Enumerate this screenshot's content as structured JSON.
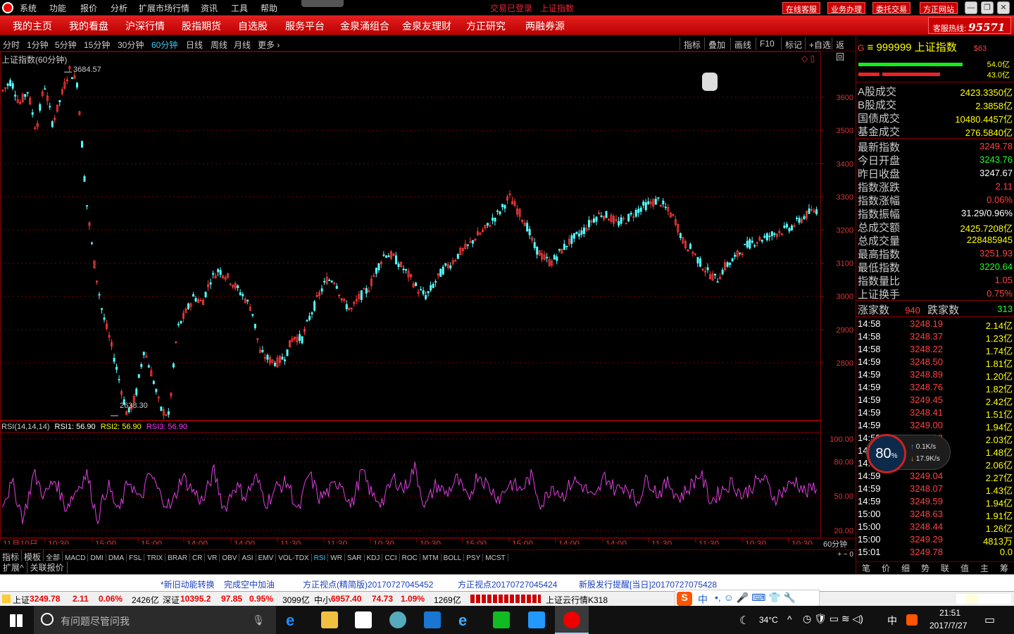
{
  "titlebar": {
    "menus": [
      "系统",
      "功能",
      "报价",
      "分析",
      "扩展市场行情",
      "资讯",
      "工具",
      "帮助"
    ],
    "status_login": "交易已登录",
    "status_index": "上证指数",
    "buttons": [
      "在线客服",
      "业务办理",
      "委托交易",
      "方正网站"
    ]
  },
  "nav": {
    "items": [
      "我的主页",
      "我的看盘",
      "沪深行情",
      "股指期货",
      "自选股",
      "服务平台",
      "金泉涌组合",
      "金泉友理财",
      "方正研究",
      "两融券源"
    ],
    "hotline_label": "客服热线:",
    "hotline_number": "95571"
  },
  "toolbar": {
    "periods": [
      "分时",
      "1分钟",
      "5分钟",
      "15分钟",
      "30分钟",
      "60分钟",
      "日线",
      "周线",
      "月线",
      "更多 ›"
    ],
    "selected_period": "60分钟",
    "right_buttons": [
      "指标",
      "叠加",
      "画线",
      "F10",
      "标记",
      "+自选",
      "返回"
    ]
  },
  "chart": {
    "title": "上证指数(60分钟)",
    "rsi_title": "RSI(14,14,14)",
    "rsi1": "RSI1: 56.90",
    "rsi2": "RSI2: 56.90",
    "rsi3": "RSI3: 56.90",
    "high_label": "3684.57",
    "low_label": "2638.30",
    "period_label": "60分钟",
    "x_labels": [
      "11月10日",
      "10:30",
      "15:00",
      "15:00",
      "14:00",
      "14:00",
      "11:30",
      "11:30",
      "10:30",
      "10:30",
      "15:00",
      "15:00",
      "14:00",
      "14:00",
      "11:30",
      "11:30",
      "10:30",
      "10:30"
    ]
  },
  "chart_data": {
    "type": "candlestick",
    "title": "上证指数(60分钟)",
    "price_axis": {
      "ticks": [
        2800,
        2900,
        3000,
        3100,
        3200,
        3300,
        3400,
        3500,
        3600
      ],
      "range": [
        2630,
        3700
      ]
    },
    "rsi_axis": {
      "ticks": [
        20.0,
        50.0,
        80.0,
        100.0
      ],
      "range": [
        15,
        105
      ]
    },
    "high": 3684.57,
    "low": 2638.3,
    "price_path": [
      3620,
      3650,
      3580,
      3620,
      3500,
      3640,
      3520,
      3600,
      3684,
      3640,
      3300,
      3100,
      2950,
      2860,
      2750,
      2640,
      2700,
      2840,
      2760,
      2660,
      2640,
      2900,
      2950,
      3000,
      2980,
      3050,
      3080,
      3060,
      3030,
      3000,
      2960,
      2830,
      2810,
      2800,
      2820,
      2880,
      2870,
      2940,
      3000,
      3050,
      3050,
      2980,
      2960,
      3000,
      3020,
      3080,
      3130,
      3120,
      3090,
      3060,
      3020,
      3000,
      3040,
      3080,
      3100,
      3130,
      3150,
      3180,
      3200,
      3230,
      3260,
      3300,
      3260,
      3220,
      3150,
      3120,
      3100,
      3130,
      3160,
      3180,
      3200,
      3230,
      3250,
      3240,
      3220,
      3230,
      3250,
      3270,
      3280,
      3290,
      3260,
      3230,
      3160,
      3140,
      3100,
      3070,
      3050,
      3090,
      3110,
      3140,
      3160,
      3170,
      3180,
      3190,
      3200,
      3210,
      3230,
      3250,
      3260
    ],
    "rsi_path": [
      45,
      60,
      30,
      70,
      50,
      65,
      40,
      55,
      70,
      30,
      60,
      35,
      65,
      45,
      70,
      50,
      40,
      68,
      55,
      45,
      72,
      38,
      60,
      50,
      66,
      44,
      58,
      62,
      35,
      70,
      48,
      55,
      64,
      40,
      72,
      50,
      45,
      66,
      56,
      75,
      40,
      60,
      52,
      65,
      46,
      70,
      58,
      48,
      62,
      55,
      67,
      42,
      60,
      50,
      64,
      58,
      46,
      68,
      55,
      60,
      44,
      66,
      52,
      62,
      48,
      58,
      70,
      45,
      55,
      62,
      50,
      60,
      66,
      48,
      56,
      64,
      52,
      60
    ]
  },
  "panel": {
    "code_prefix": "G",
    "code": "999999",
    "name": "上证指数",
    "badge": "$63",
    "bar1_value": "54.0亿",
    "bar2_value": "43.0亿",
    "stats1": [
      {
        "k": "A股成交",
        "v": "2423.3350亿",
        "c": "yel"
      },
      {
        "k": "B股成交",
        "v": "2.3858亿",
        "c": "yel"
      },
      {
        "k": "国债成交",
        "v": "10480.4457亿",
        "c": "yel"
      },
      {
        "k": "基金成交",
        "v": "276.5840亿",
        "c": "yel"
      }
    ],
    "stats2": [
      {
        "k": "最新指数",
        "v": "3249.78",
        "c": "red"
      },
      {
        "k": "今日开盘",
        "v": "3243.76",
        "c": "grn"
      },
      {
        "k": "昨日收盘",
        "v": "3247.67",
        "c": "wht"
      },
      {
        "k": "指数涨跌",
        "v": "2.11",
        "c": "red"
      },
      {
        "k": "指数涨幅",
        "v": "0.06%",
        "c": "red"
      },
      {
        "k": "指数振幅",
        "v": "31.29/0.96%",
        "c": "wht"
      },
      {
        "k": "总成交额",
        "v": "2425.7208亿",
        "c": "yel"
      },
      {
        "k": "总成交量",
        "v": "228485945",
        "c": "yel"
      },
      {
        "k": "最高指数",
        "v": "3251.93",
        "c": "red"
      },
      {
        "k": "最低指数",
        "v": "3220.64",
        "c": "grn"
      },
      {
        "k": "指数量比",
        "v": "1.05",
        "c": "red"
      },
      {
        "k": "上证换手",
        "v": "0.75%",
        "c": "red"
      }
    ],
    "rise_label": "涨家数",
    "rise": "940",
    "fall_label": "跌家数",
    "fall": "313",
    "ticks": [
      {
        "t": "14:58",
        "p": "3248.19",
        "v": "2.14亿"
      },
      {
        "t": "14:58",
        "p": "3248.37",
        "v": "1.23亿"
      },
      {
        "t": "14:58",
        "p": "3248.22",
        "v": "1.74亿"
      },
      {
        "t": "14:59",
        "p": "3248.50",
        "v": "1.81亿"
      },
      {
        "t": "14:59",
        "p": "3248.89",
        "v": "1.20亿"
      },
      {
        "t": "14:59",
        "p": "3248.76",
        "v": "1.82亿"
      },
      {
        "t": "14:59",
        "p": "3249.45",
        "v": "2.42亿"
      },
      {
        "t": "14:59",
        "p": "3248.41",
        "v": "1.51亿"
      },
      {
        "t": "14:59",
        "p": "3249.00",
        "v": "1.94亿"
      },
      {
        "t": "14:59",
        "p": "3247.93",
        "v": "2.03亿"
      },
      {
        "t": "14:59",
        "p": "",
        "v": "1.48亿"
      },
      {
        "t": "14:59",
        "p": "",
        "v": "2.06亿"
      },
      {
        "t": "14:59",
        "p": "3249.04",
        "v": "2.27亿"
      },
      {
        "t": "14:59",
        "p": "3248.07",
        "v": "1.43亿"
      },
      {
        "t": "14:59",
        "p": "3249.59",
        "v": "1.94亿"
      },
      {
        "t": "15:00",
        "p": "3248.63",
        "v": "1.91亿"
      },
      {
        "t": "15:00",
        "p": "3248.44",
        "v": "1.26亿"
      },
      {
        "t": "15:00",
        "p": "3249.29",
        "v": "4813万"
      },
      {
        "t": "15:01",
        "p": "3249.78",
        "v": "0.0"
      }
    ],
    "tabs": [
      "笔",
      "价",
      "细",
      "势",
      "联",
      "值",
      "主",
      "筹"
    ]
  },
  "bottom_tabs": {
    "row1": [
      "指标",
      "模板",
      "全部",
      "MACD",
      "DMI",
      "DMA",
      "FSL",
      "TRIX",
      "BRAR",
      "CR",
      "VR",
      "OBV",
      "ASI",
      "EMV",
      "VOL-TDX",
      "RSI",
      "WR",
      "SAR",
      "KDJ",
      "CCI",
      "ROC",
      "MTM",
      "BOLL",
      "PSY",
      "MCST"
    ],
    "row2": [
      "扩展^",
      "关联报价"
    ]
  },
  "news": [
    "*新旧动能转换",
    "完成空中加油",
    "方正视点(精简版)20170727045452",
    "方正视点20170727045424",
    "新股发行提醒[当日]20170727075428"
  ],
  "status": {
    "sh_label": "上证",
    "sh_val": "3249.78",
    "sh_chg": "2.11",
    "sh_pct": "0.06%",
    "sh_amt": "2426亿",
    "sz_label": "深证",
    "sz_val": "10395.2",
    "sz_chg": "97.85",
    "sz_pct": "0.95%",
    "sz_amt": "3099亿",
    "zx_label": "中小",
    "zx_val": "6957.40",
    "zx_chg": "74.73",
    "zx_pct": "1.09%",
    "zx_amt": "1269亿",
    "cloud": "上证云行情K318"
  },
  "taskbar": {
    "search_placeholder": "有问题尽管问我",
    "temp": "34°C",
    "ime": "中",
    "time": "21:51",
    "date": "2017/7/27"
  },
  "net_widget": {
    "percent": "80",
    "up": "0.1K/s",
    "down": "17.9K/s"
  }
}
